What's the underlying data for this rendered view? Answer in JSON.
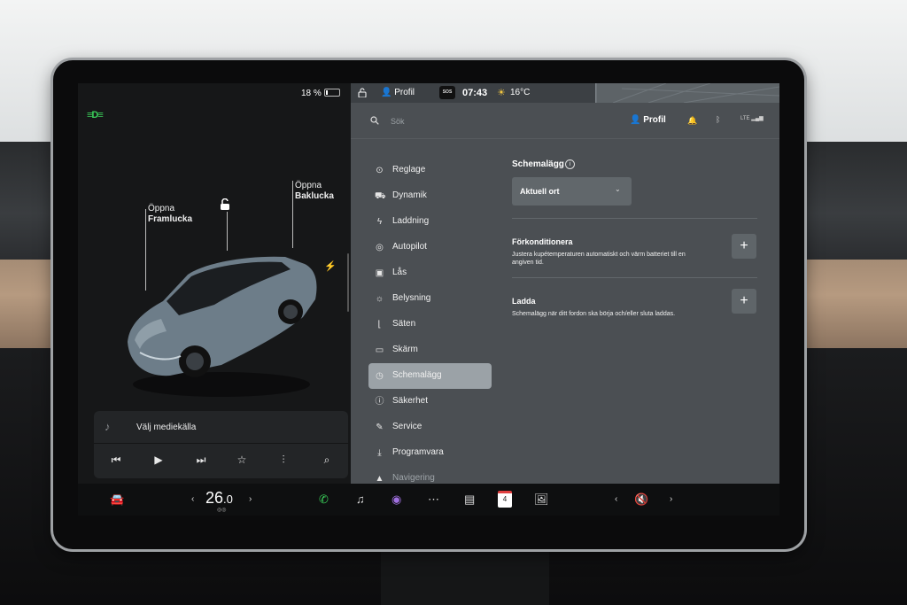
{
  "status": {
    "battery_percent": "18 %",
    "battery_level": 0.18,
    "profile": "Profil",
    "sos": "SOS",
    "time": "07:43",
    "temperature": "16°C"
  },
  "car_panel": {
    "frunk_label_line1": "Öppna",
    "frunk_label_line2": "Framlucka",
    "trunk_label_line1": "Öppna",
    "trunk_label_line2": "Baklucka"
  },
  "media": {
    "source_label": "Välj mediekälla"
  },
  "search": {
    "placeholder": "Sök",
    "profile": "Profil",
    "network": "LTE"
  },
  "menu": {
    "items": [
      {
        "label": "Reglage",
        "icon": "toggle-icon"
      },
      {
        "label": "Dynamik",
        "icon": "car-icon"
      },
      {
        "label": "Laddning",
        "icon": "bolt-icon"
      },
      {
        "label": "Autopilot",
        "icon": "steering-wheel-icon"
      },
      {
        "label": "Lås",
        "icon": "lock-icon"
      },
      {
        "label": "Belysning",
        "icon": "sun-icon"
      },
      {
        "label": "Säten",
        "icon": "seat-icon"
      },
      {
        "label": "Skärm",
        "icon": "display-icon"
      },
      {
        "label": "Schemalägg",
        "icon": "clock-icon",
        "active": true
      },
      {
        "label": "Säkerhet",
        "icon": "alert-icon"
      },
      {
        "label": "Service",
        "icon": "wrench-icon"
      },
      {
        "label": "Programvara",
        "icon": "download-icon"
      },
      {
        "label": "Navigering",
        "icon": "navigation-icon"
      }
    ]
  },
  "schedule": {
    "title": "Schemalägg",
    "location_value": "Aktuell ort",
    "precondition_title": "Förkonditionera",
    "precondition_desc": "Justera kupétemperaturen automatiskt och värm batteriet till en angiven tid.",
    "charge_title": "Ladda",
    "charge_desc": "Schemalägg när ditt fordon ska börja och/eller sluta laddas.",
    "plus": "+"
  },
  "dock": {
    "cabin_temp_int": "26",
    "cabin_temp_dec": ".0",
    "calendar_day": "4"
  },
  "colors": {
    "accent_green": "#3ad05a",
    "menu_active": "#9ba2a7",
    "panel_bg": "#4b4f53"
  }
}
